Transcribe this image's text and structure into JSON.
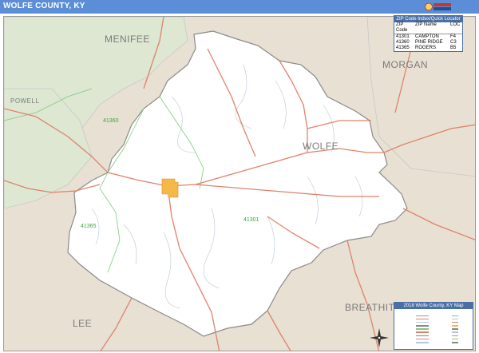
{
  "title": "WOLFE COUNTY, KY",
  "map": {
    "main_county": "WOLFE",
    "neighbor_counties": [
      "MENIFEE",
      "POWELL",
      "MORGAN",
      "BREATHITT",
      "LEE"
    ],
    "zip_area_labels": [
      "41360",
      "41365",
      "41301"
    ],
    "colors": {
      "county_fill": "#ffffff",
      "neighbor_green": "#dde7d2",
      "neighbor_tan": "#e8e0d2",
      "city_fill": "#f5b94a",
      "road_major": "#e0826a",
      "road_minor": "#b7c6d8",
      "zip_boundary": "#7fc97f",
      "county_border": "#8a8a8a",
      "title_bar": "#5b8ed6"
    }
  },
  "zip_table": {
    "header": "ZIP Code Index/Quick Locator",
    "columns": [
      "ZIP Code",
      "ZIP Name",
      "LOC"
    ],
    "rows": [
      [
        "41301",
        "CAMPTON",
        "F4"
      ],
      [
        "41360",
        "PINE RIDGE",
        "C3"
      ],
      [
        "41365",
        "ROGERS",
        "B5"
      ]
    ]
  },
  "legend": {
    "title": "2018 Wolfe County, KY Map"
  },
  "compass": {
    "n": "N",
    "s": "S",
    "e": "E",
    "w": "W"
  }
}
